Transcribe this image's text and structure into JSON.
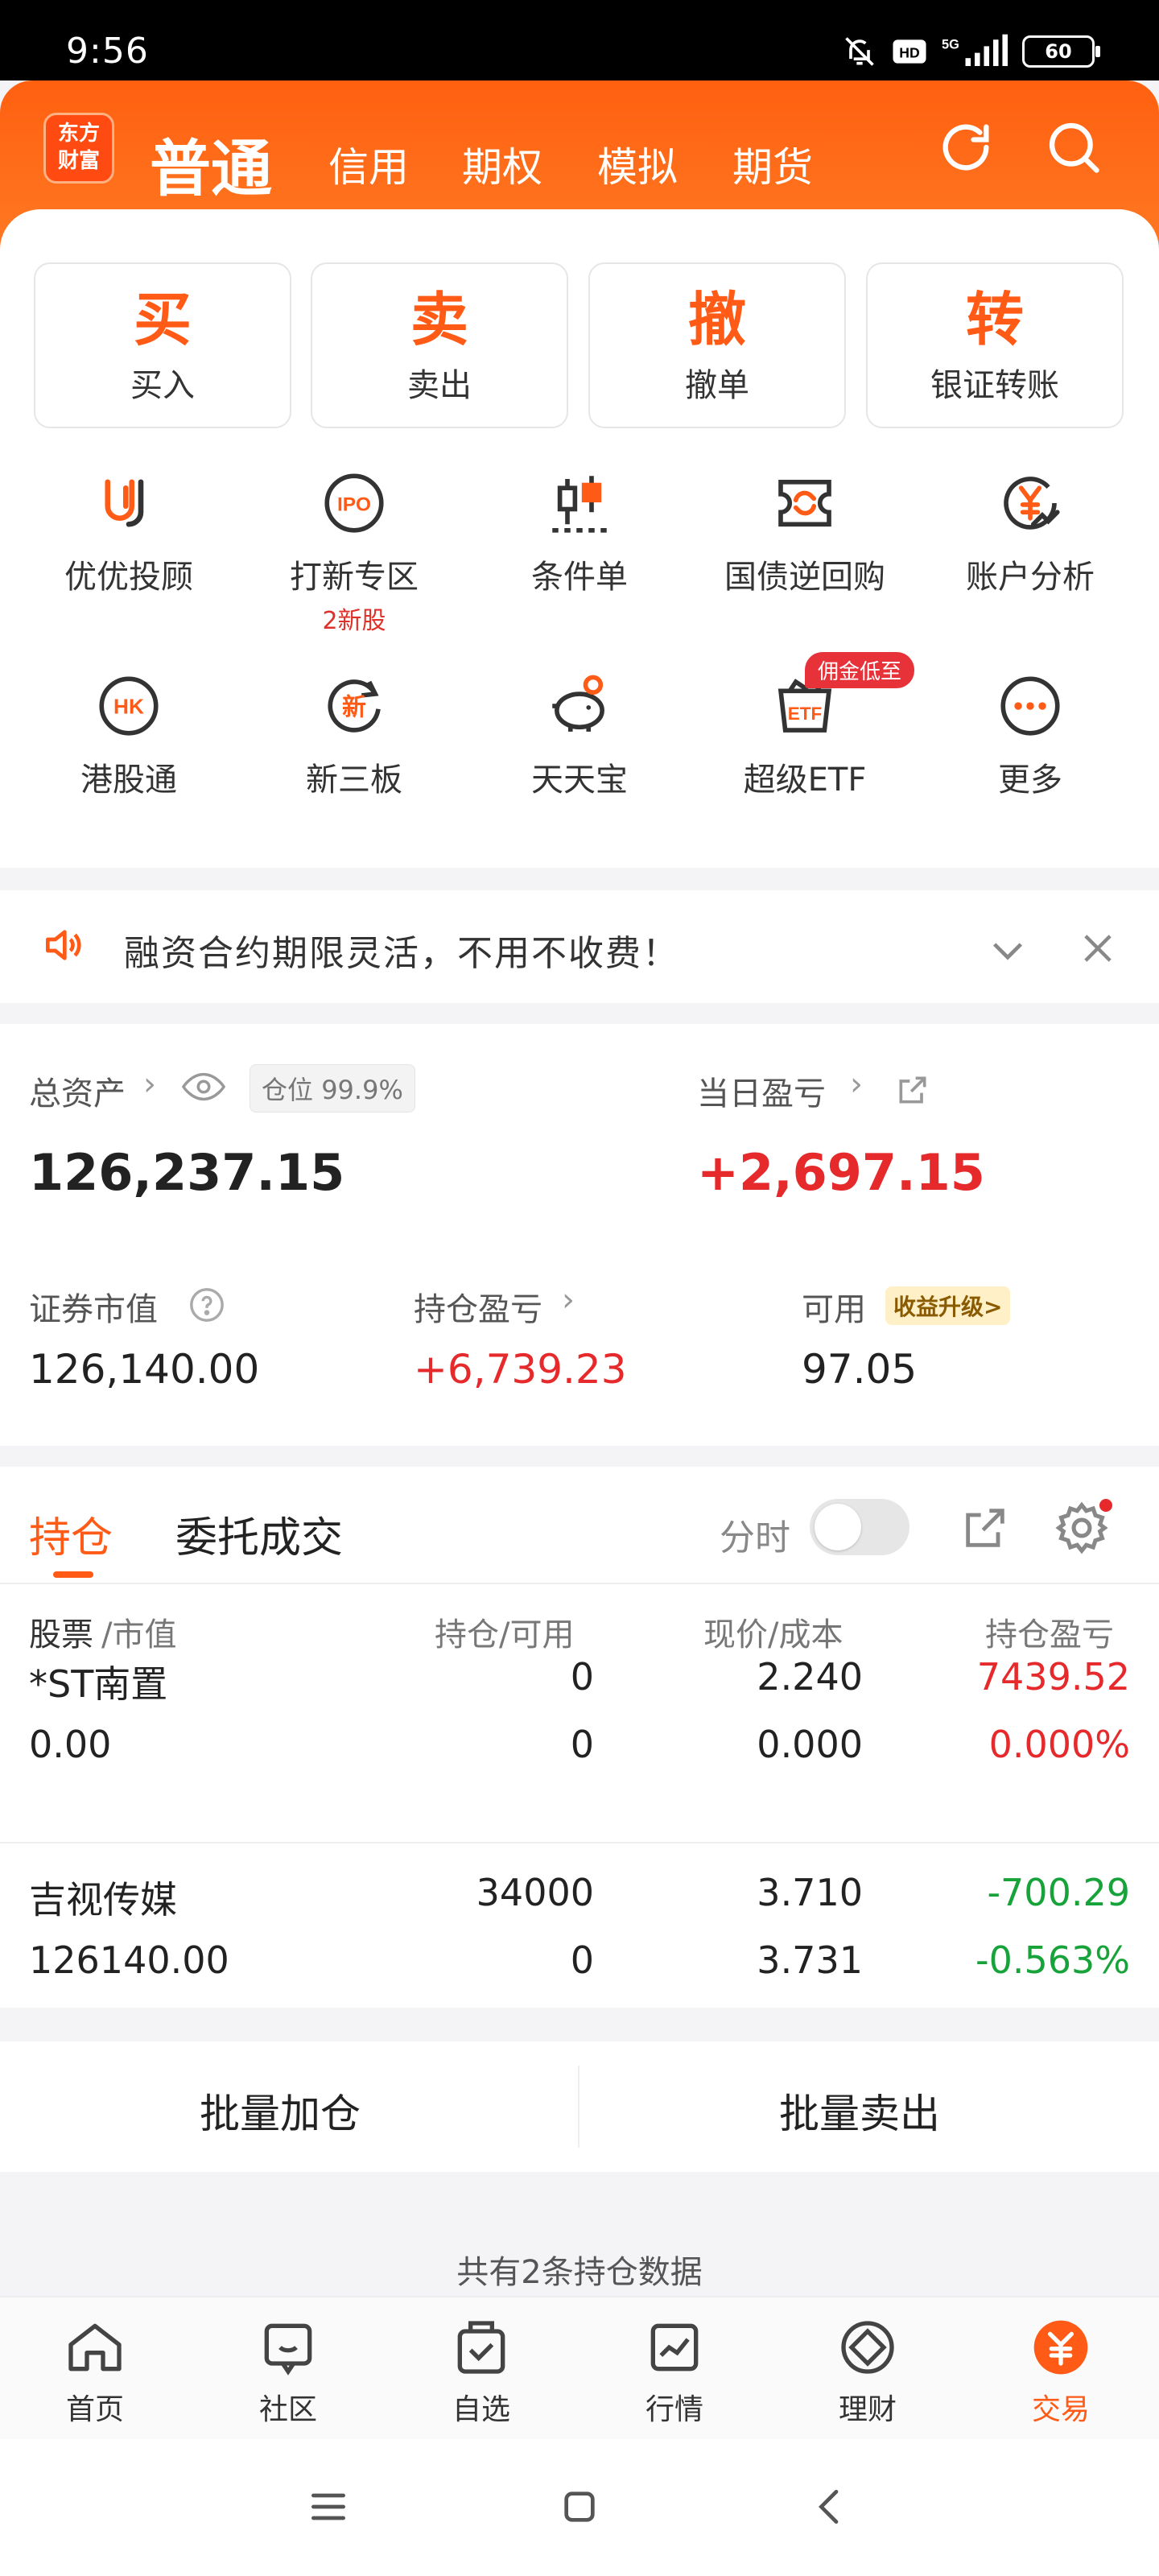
{
  "status_bar": {
    "time": "9:56",
    "battery": "60"
  },
  "header": {
    "logo_line1": "东方",
    "logo_line2": "财富",
    "tabs": [
      {
        "label": "普通",
        "active": true
      },
      {
        "label": "信用"
      },
      {
        "label": "期权"
      },
      {
        "label": "模拟"
      },
      {
        "label": "期货"
      }
    ]
  },
  "quick_actions": [
    {
      "glyph": "买",
      "label": "买入"
    },
    {
      "glyph": "卖",
      "label": "卖出"
    },
    {
      "glyph": "撤",
      "label": "撤单"
    },
    {
      "glyph": "转",
      "label": "银证转账"
    }
  ],
  "features": [
    {
      "icon": "youyou-icon",
      "label": "优优投顾"
    },
    {
      "icon": "ipo-icon",
      "label": "打新专区",
      "sub": "2新股"
    },
    {
      "icon": "candlestick-icon",
      "label": "条件单"
    },
    {
      "icon": "repo-icon",
      "label": "国债逆回购"
    },
    {
      "icon": "yen-chart-icon",
      "label": "账户分析"
    },
    {
      "icon": "hk-icon",
      "label": "港股通"
    },
    {
      "icon": "xin-icon",
      "label": "新三板"
    },
    {
      "icon": "piggy-bank-icon",
      "label": "天天宝"
    },
    {
      "icon": "etf-icon",
      "label": "超级ETF",
      "badge": "佣金低至"
    },
    {
      "icon": "more-icon",
      "label": "更多"
    }
  ],
  "notice": {
    "text": "融资合约期限灵活，不用不收费！"
  },
  "assets": {
    "total_label": "总资产",
    "position_label": "仓位",
    "position_value": "99.9%",
    "total_value": "126,237.15",
    "daily_pl_label": "当日盈亏",
    "daily_pl_value": "+2,697.15",
    "market_value_label": "证券市值",
    "market_value": "126,140.00",
    "holding_pl_label": "持仓盈亏",
    "holding_pl_value": "+6,739.23",
    "available_label": "可用",
    "available_badge": "收益升级>",
    "available_value": "97.05"
  },
  "holdings": {
    "tab_positions": "持仓",
    "tab_orders": "委托成交",
    "timeshare_label": "分时",
    "col_stock": "股票",
    "col_stock_sub": "/市值",
    "col_qty": "持仓/可用",
    "col_price": "现价/成本",
    "col_pl": "持仓盈亏",
    "rows": [
      {
        "name": "*ST南置",
        "value": "0.00",
        "qty": "0",
        "avail": "0",
        "price": "2.240",
        "cost": "0.000",
        "pl": "7439.52",
        "pl_pct": "0.000%",
        "dir": "up"
      },
      {
        "name": "吉视传媒",
        "value": "126140.00",
        "qty": "34000",
        "avail": "0",
        "price": "3.710",
        "cost": "3.731",
        "pl": "-700.29",
        "pl_pct": "-0.563%",
        "dir": "down"
      }
    ]
  },
  "actions": {
    "batch_add": "批量加仓",
    "batch_sell": "批量卖出"
  },
  "footer_note": "共有2条持仓数据",
  "bottom_nav": [
    {
      "icon": "home-icon",
      "label": "首页"
    },
    {
      "icon": "community-icon",
      "label": "社区"
    },
    {
      "icon": "watchlist-icon",
      "label": "自选"
    },
    {
      "icon": "market-icon",
      "label": "行情"
    },
    {
      "icon": "wealth-icon",
      "label": "理财"
    },
    {
      "icon": "trade-icon",
      "label": "交易",
      "active": true
    }
  ],
  "colors": {
    "accent": "#ff5a16",
    "up": "#e6292b",
    "down": "#17a33a"
  }
}
